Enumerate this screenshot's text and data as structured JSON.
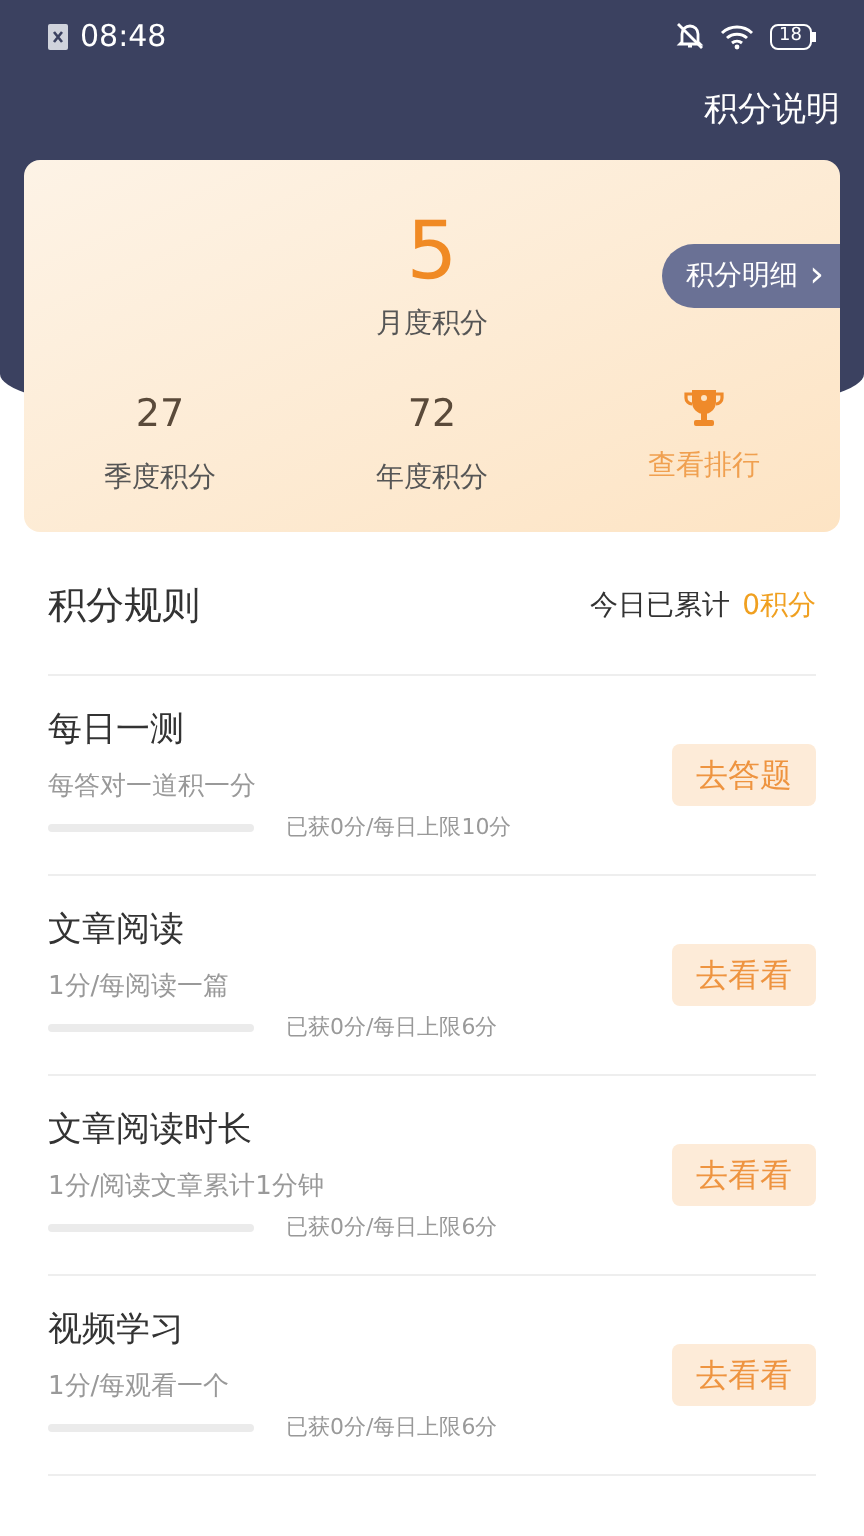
{
  "status_bar": {
    "time": "08:48",
    "battery": "18"
  },
  "header": {
    "link": "积分说明"
  },
  "summary": {
    "monthly_value": "5",
    "monthly_label": "月度积分",
    "detail_button": "积分明细",
    "detail_arrow": "›",
    "stats": [
      {
        "value": "27",
        "label": "季度积分"
      },
      {
        "value": "72",
        "label": "年度积分"
      }
    ],
    "ranking": "查看排行"
  },
  "rules": {
    "title": "积分规则",
    "today_label": "今日已累计",
    "today_value": "0积分",
    "items": [
      {
        "name": "每日一测",
        "desc": "每答对一道积一分",
        "level": 0,
        "progress": "已获0分/每日上限10分",
        "button": "去答题"
      },
      {
        "name": "文章阅读",
        "desc": "1分/每阅读一篇",
        "level": 0,
        "progress": "已获0分/每日上限6分",
        "button": "去看看"
      },
      {
        "name": "文章阅读时长",
        "desc": "1分/阅读文章累计1分钟",
        "level": 0,
        "progress": "已获0分/每日上限6分",
        "button": "去看看"
      },
      {
        "name": "视频学习",
        "desc": "1分/每观看一个",
        "level": 0,
        "progress": "已获0分/每日上限6分",
        "button": "去看看"
      }
    ]
  }
}
